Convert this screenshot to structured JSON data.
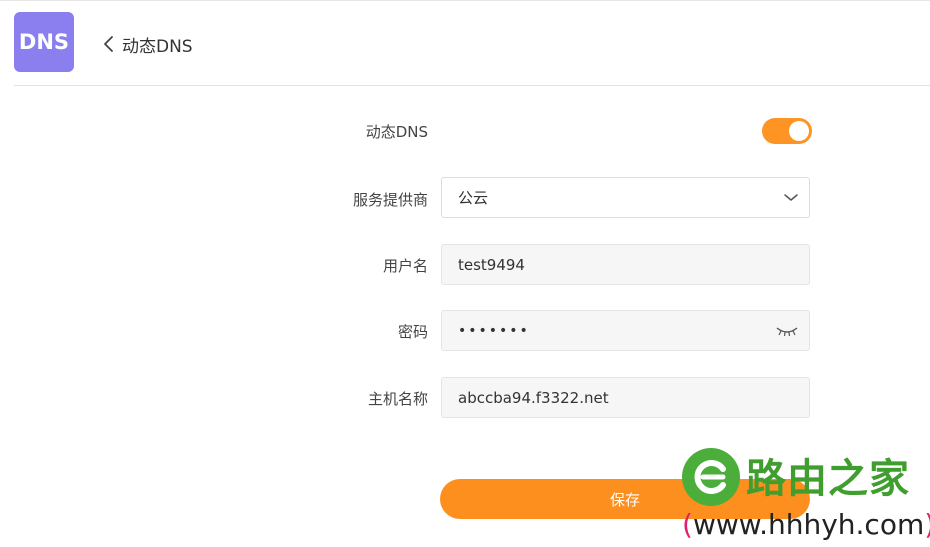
{
  "header": {
    "logo_text": "DNS",
    "title": "动态DNS"
  },
  "form": {
    "ddns_label": "动态DNS",
    "ddns_enabled": true,
    "provider_label": "服务提供商",
    "provider_value": "公云",
    "username_label": "用户名",
    "username_value": "test9494",
    "password_label": "密码",
    "password_mask": "•••••••",
    "hostname_label": "主机名称",
    "hostname_value": "abccba94.f3322.net",
    "save_label": "保存"
  },
  "watermark": {
    "brand": "路由之家",
    "url_open": "(",
    "url": "www.hhhyh.com",
    "url_close": ")"
  },
  "colors": {
    "accent": "#fd9424",
    "logo_bg": "#8b7ff0",
    "watermark_green": "#3f9e2e"
  }
}
